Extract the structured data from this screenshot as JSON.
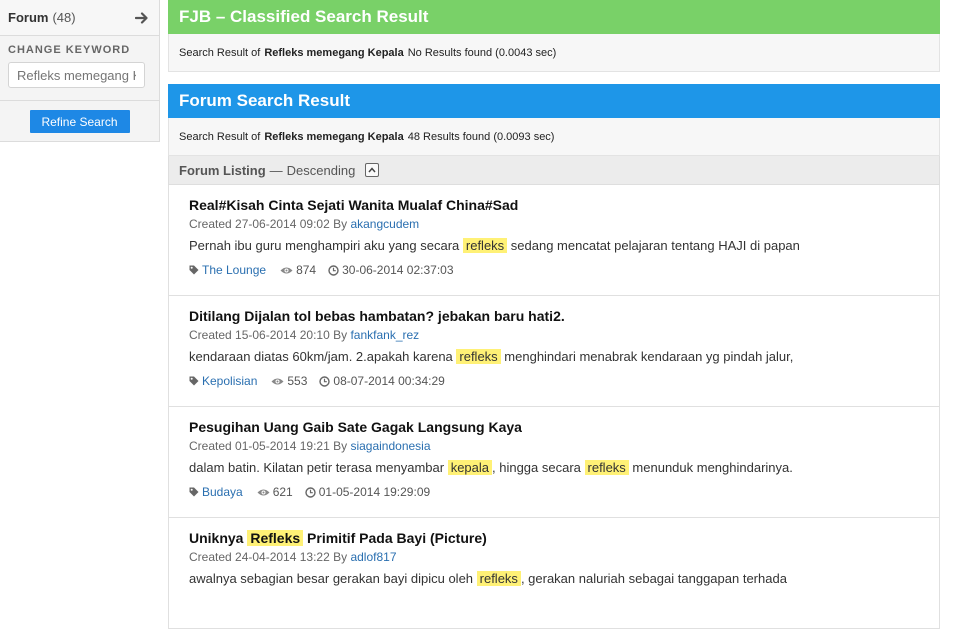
{
  "sidebar": {
    "forum_label": "Forum",
    "forum_count": "(48)",
    "change_keyword_title": "CHANGE KEYWORD",
    "keyword_placeholder": "Refleks memegang Ke",
    "refine_button": "Refine Search"
  },
  "fjb": {
    "title": "FJB – Classified Search Result",
    "prefix": "Search Result of",
    "keyword": "Refleks memegang Kepala",
    "result": "No Results found (0.0043 sec)"
  },
  "forum": {
    "title": "Forum Search Result",
    "prefix": "Search Result of",
    "keyword": "Refleks memegang Kepala",
    "result": "48 Results found (0.0093 sec)"
  },
  "listing": {
    "label": "Forum Listing",
    "separator": "—",
    "order": "Descending"
  },
  "items": [
    {
      "title_parts": [
        "Real#Kisah Cinta Sejati Wanita Mualaf China#Sad"
      ],
      "created": "Created 27-06-2014 09:02 By",
      "author": "akangcudem",
      "snippet_parts": [
        "Pernah ibu guru menghampiri aku yang secara ",
        "refleks",
        " sedang mencatat pelajaran tentang HAJI di papan"
      ],
      "category": "The Lounge",
      "views": "874",
      "date": "30-06-2014 02:37:03"
    },
    {
      "title_parts": [
        "Ditilang Dijalan tol bebas hambatan? jebakan baru hati2."
      ],
      "created": "Created 15-06-2014 20:10 By",
      "author": "fankfank_rez",
      "snippet_parts": [
        "kendaraan diatas 60km/jam. 2.apakah karena ",
        "refleks",
        " menghindari menabrak kendaraan yg pindah jalur,"
      ],
      "category": "Kepolisian",
      "views": "553",
      "date": "08-07-2014 00:34:29"
    },
    {
      "title_parts": [
        "Pesugihan Uang Gaib Sate Gagak Langsung Kaya"
      ],
      "created": "Created 01-05-2014 19:21 By",
      "author": "siagaindonesia",
      "snippet_parts": [
        "dalam batin. Kilatan petir terasa menyambar ",
        "kepala",
        ", hingga secara ",
        "refleks",
        " menunduk menghindarinya."
      ],
      "category": "Budaya",
      "views": "621",
      "date": "01-05-2014 19:29:09"
    },
    {
      "title_parts": [
        "Uniknya ",
        "Refleks",
        " Primitif Pada Bayi (Picture)"
      ],
      "created": "Created 24-04-2014 13:22 By",
      "author": "adlof817",
      "snippet_parts": [
        "awalnya sebagian besar gerakan bayi dipicu oleh ",
        "refleks",
        ", gerakan naluriah sebagai tanggapan terhada"
      ],
      "category": "",
      "views": "",
      "date": ""
    }
  ],
  "colors": {
    "fjb_header": "#79d168",
    "forum_header": "#1e96e8",
    "highlight": "#fff176",
    "link": "#2a6fb0"
  },
  "icons": {
    "forum_arrow": "arrow-right-icon",
    "sort": "chevron-up-icon",
    "category": "tag-icon",
    "views": "eye-icon",
    "date": "clock-icon"
  }
}
